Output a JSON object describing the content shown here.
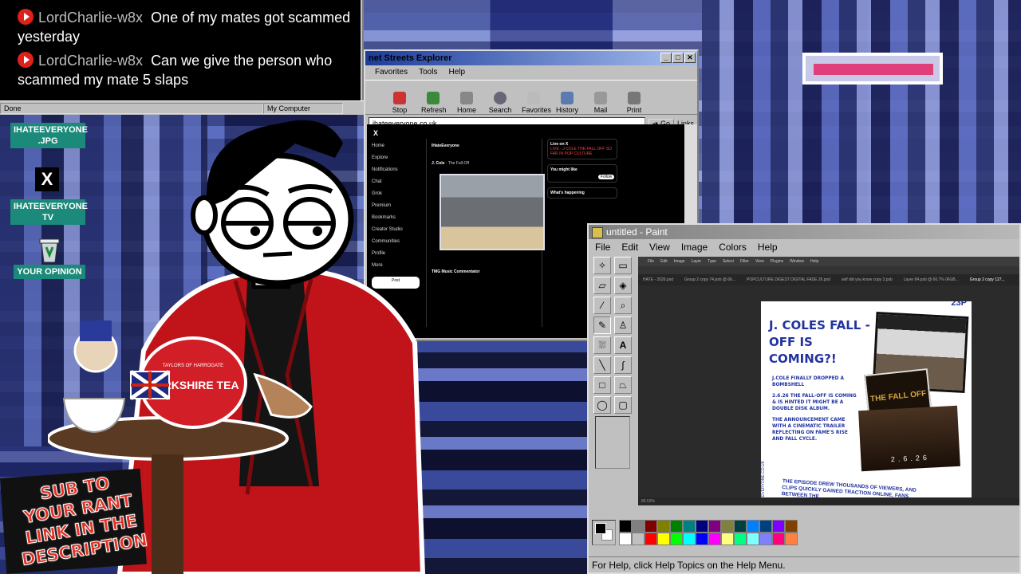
{
  "chat": {
    "messages": [
      {
        "user": "LordCharlie-w8x",
        "text": "One of my mates got scammed yesterday"
      },
      {
        "user": "LordCharlie-w8x",
        "text": "Can we give the person who scammed my mate 5 slaps"
      }
    ],
    "status_left": "Done",
    "status_right": "My Computer"
  },
  "desktop": {
    "icons": [
      {
        "label": "IHATEEVERYONE .JPG",
        "icon": "image-file-icon"
      },
      {
        "label": "X",
        "icon": "x-logo-icon"
      },
      {
        "label": "IHATEEVERYONE TV",
        "icon": "tv-icon"
      },
      {
        "label": "YOUR OPINION",
        "icon": "recycle-bin-icon"
      }
    ]
  },
  "ie": {
    "title": "net Streets Explorer",
    "menu": [
      "Favorites",
      "Tools",
      "Help"
    ],
    "toolbar": [
      "Stop",
      "Refresh",
      "Home",
      "Search",
      "Favorites",
      "History",
      "Mail",
      "Print"
    ],
    "address": "ihateeveryone.co.uk",
    "go": "Go",
    "links": "Links",
    "x_nav": [
      "Home",
      "Explore",
      "Notifications",
      "Chat",
      "Grok",
      "Premium",
      "Bookmarks",
      "Creator Studio",
      "Communities",
      "Profile",
      "More"
    ],
    "x_post_button": "Post",
    "feed_account": "IHateEveryone",
    "feed_author": "J. Cole",
    "feed_caption": "The Fall-Off",
    "feed_second_author": "TMG Music Commentator",
    "live_title": "Live on X",
    "live_item": "LIVE - J COLE THE FALL OFF SO FAR IN POP CULTURE",
    "follow_title": "You might like",
    "follow_button": "Follow",
    "trending_title": "What's happening"
  },
  "paint": {
    "title": "untitled - Paint",
    "menu": [
      "File",
      "Edit",
      "View",
      "Image",
      "Colors",
      "Help"
    ],
    "status": "For Help, click Help Topics on the Help Menu.",
    "ps_menu": [
      "File",
      "Edit",
      "Image",
      "Layer",
      "Type",
      "Select",
      "Filter",
      "View",
      "Plugins",
      "Window",
      "Help"
    ],
    "ps_tabs": [
      "HATE - 2026.psd",
      "Group 2 copy 74.psb @ 66...",
      "POPCULTURE DIGEST DIGITAL FADE 26.psd",
      "self did you know copy 3.psb",
      "Layer 84.psb @ 66.7% (RGB...",
      "Group 2 copy 127..."
    ],
    "ps_zoom": "80.53%",
    "palette": [
      "#000000",
      "#808080",
      "#800000",
      "#808000",
      "#008000",
      "#008080",
      "#000080",
      "#800080",
      "#808040",
      "#004040",
      "#0080ff",
      "#004080",
      "#8000ff",
      "#804000",
      "#ffffff",
      "#c0c0c0",
      "#ff0000",
      "#ffff00",
      "#00ff00",
      "#00ffff",
      "#0000ff",
      "#ff00ff",
      "#ffff80",
      "#00ff80",
      "#80ffff",
      "#8080ff",
      "#ff0080",
      "#ff8040"
    ]
  },
  "doc": {
    "title": "J. COLES FALL - OFF IS COMING?!",
    "corner": "23P",
    "p1": "J.COLE FINALLY DROPPED A BOMBSHELL",
    "p2": "2.6.26 THE FALL-OFF IS COMING & IS HINTED IT MIGHT BE A DOUBLE DISK ALBUM.",
    "p3": "THE ANNOUNCEMENT CAME WITH A CINEMATIC TRAILER REFLECTING ON FAME'S RISE AND FALL CYCLE.",
    "footer": "THE EPISODE DREW THOUSANDS OF VIEWERS, AND CLIPS QUICKLY GAINED TRACTION ONLINE, FANS BETWEEN THE",
    "site": "IHATEEVERYONE.CO.UK",
    "album_label": "THE FALL OFF",
    "date_label": "2.6.26"
  },
  "teapot_label": "YORKSHIRE TEA",
  "teapot_brand": "TAYLORS OF HARROGATE",
  "badge": {
    "text": "SUB TO YOUR RANT LINK IN THE DESCRIPTION"
  },
  "colors": {
    "chat_bg": "#000000",
    "teal_label": "#1c8a7a",
    "doc_blue": "#2233a0",
    "jacket": "#c0141a"
  }
}
